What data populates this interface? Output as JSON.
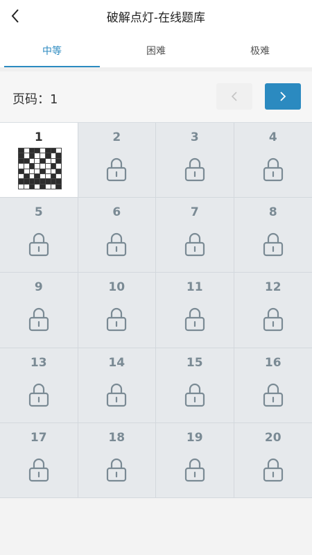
{
  "header": {
    "title": "破解点灯-在线题库",
    "back_icon": "chevron-left-icon"
  },
  "tabs": [
    {
      "label": "中等",
      "active": true
    },
    {
      "label": "困难",
      "active": false
    },
    {
      "label": "极难",
      "active": false
    }
  ],
  "pager": {
    "label": "页码：1",
    "prev_icon": "chevron-left-icon",
    "next_icon": "chevron-right-icon",
    "prev_enabled": false,
    "next_enabled": true
  },
  "colors": {
    "accent": "#2b8ac0",
    "locked_cell": "#e6e9ec",
    "lock_icon": "#7a8a94"
  },
  "levels": [
    {
      "number": "1",
      "locked": false
    },
    {
      "number": "2",
      "locked": true
    },
    {
      "number": "3",
      "locked": true
    },
    {
      "number": "4",
      "locked": true
    },
    {
      "number": "5",
      "locked": true
    },
    {
      "number": "6",
      "locked": true
    },
    {
      "number": "7",
      "locked": true
    },
    {
      "number": "8",
      "locked": true
    },
    {
      "number": "9",
      "locked": true
    },
    {
      "number": "10",
      "locked": true
    },
    {
      "number": "11",
      "locked": true
    },
    {
      "number": "12",
      "locked": true
    },
    {
      "number": "13",
      "locked": true
    },
    {
      "number": "14",
      "locked": true
    },
    {
      "number": "15",
      "locked": true
    },
    {
      "number": "16",
      "locked": true
    },
    {
      "number": "17",
      "locked": true
    },
    {
      "number": "18",
      "locked": true
    },
    {
      "number": "19",
      "locked": true
    },
    {
      "number": "20",
      "locked": true
    }
  ],
  "preview_pattern": [
    [
      1,
      0,
      1,
      1,
      0,
      1,
      1,
      0
    ],
    [
      1,
      0,
      1,
      0,
      0,
      1,
      0,
      1
    ],
    [
      1,
      1,
      0,
      0,
      1,
      0,
      0,
      1
    ],
    [
      0,
      0,
      1,
      0,
      0,
      0,
      1,
      0
    ],
    [
      1,
      0,
      0,
      0,
      1,
      0,
      0,
      1
    ],
    [
      0,
      1,
      0,
      1,
      0,
      0,
      1,
      0
    ],
    [
      1,
      1,
      1,
      1,
      1,
      1,
      1,
      1
    ],
    [
      0,
      0,
      1,
      0,
      1,
      0,
      0,
      1
    ]
  ]
}
